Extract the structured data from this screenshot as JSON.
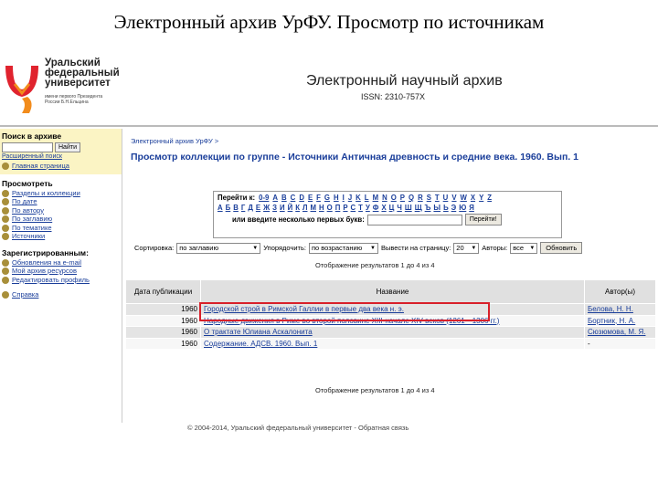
{
  "slide_title": "Электронный архив УрФУ. Просмотр по источникам",
  "logo": {
    "line1": "Уральский",
    "line2": "федеральный",
    "line3": "университет",
    "sub1": "имени первого Президента",
    "sub2": "России Б.Н.Ельцина",
    "colors": {
      "red": "#e0232e",
      "orange": "#f28c1c"
    }
  },
  "header": {
    "archive_title": "Электронный научный архив",
    "issn": "ISSN: 2310-757X"
  },
  "sidebar": {
    "search_head": "Поиск в архиве",
    "search_value": "",
    "search_button": "Найти",
    "advanced_search": "Расширенный поиск",
    "home": "Главная страница",
    "browse_head": "Просмотреть",
    "browse_items": [
      "Разделы и коллекции",
      "По дате",
      "По автору",
      "По заглавию",
      "По тематике",
      "Источники"
    ],
    "registered_head": "Зарегистрированным:",
    "registered_items": [
      "Обновления на e-mail",
      "Мой архив ресурсов",
      "Редактировать профиль"
    ],
    "help": "Справка",
    "bullet_color": "#a88f3a"
  },
  "main": {
    "breadcrumb": "Электронный архив УрФУ >",
    "heading": "Просмотр коллекции по группе - Источники Античная древность и средние века. 1960. Вып. 1",
    "jump_label": "Перейти к:",
    "latin": [
      "0-9",
      "A",
      "B",
      "C",
      "D",
      "E",
      "F",
      "G",
      "H",
      "I",
      "J",
      "K",
      "L",
      "M",
      "N",
      "O",
      "P",
      "Q",
      "R",
      "S",
      "T",
      "U",
      "V",
      "W",
      "X",
      "Y",
      "Z"
    ],
    "cyrillic": [
      "А",
      "Б",
      "В",
      "Г",
      "Д",
      "Е",
      "Ж",
      "З",
      "И",
      "Й",
      "К",
      "Л",
      "М",
      "Н",
      "О",
      "П",
      "Р",
      "С",
      "Т",
      "У",
      "Ф",
      "Х",
      "Ц",
      "Ч",
      "Ш",
      "Щ",
      "Ъ",
      "Ы",
      "Ь",
      "Э",
      "Ю",
      "Я"
    ],
    "first_letters_label": "или введите несколько первых букв:",
    "first_letters_value": "",
    "jump_button": "Перейти!",
    "sort_label": "Сортировка:",
    "sort_value": "по заглавию",
    "order_label": "Упорядочить:",
    "order_value": "по возрастанию",
    "per_page_label": "Вывести на страницу:",
    "per_page_value": "20",
    "authors_label": "Авторы:",
    "authors_value": "все",
    "update_button": "Обновить",
    "showing_top": "Отображение результатов 1 до 4 из 4",
    "showing_bottom": "Отображение результатов 1 до 4 из 4",
    "columns": {
      "date": "Дата публикации",
      "title": "Название",
      "author": "Автор(ы)"
    },
    "rows": [
      {
        "date": "1960",
        "title": "Городской строй в Римской Галлии в первые два века н. э.",
        "author": "Белова, Н. Н."
      },
      {
        "date": "1960",
        "title": "Народные движения в Риме во второй половине XIII-начале XIV веков (1261—1306 гг.)",
        "author": "Бортник, Н. А."
      },
      {
        "date": "1960",
        "title": "О трактате Юлиана Аскалонита",
        "author": "Сюзюмова, М. Я."
      },
      {
        "date": "1960",
        "title": "Содержание. АДСВ. 1960. Вып. 1",
        "author": "-"
      }
    ],
    "highlight_color": "#d8202a"
  },
  "footer": "© 2004-2014, Уральский федеральный университет - Обратная связь"
}
